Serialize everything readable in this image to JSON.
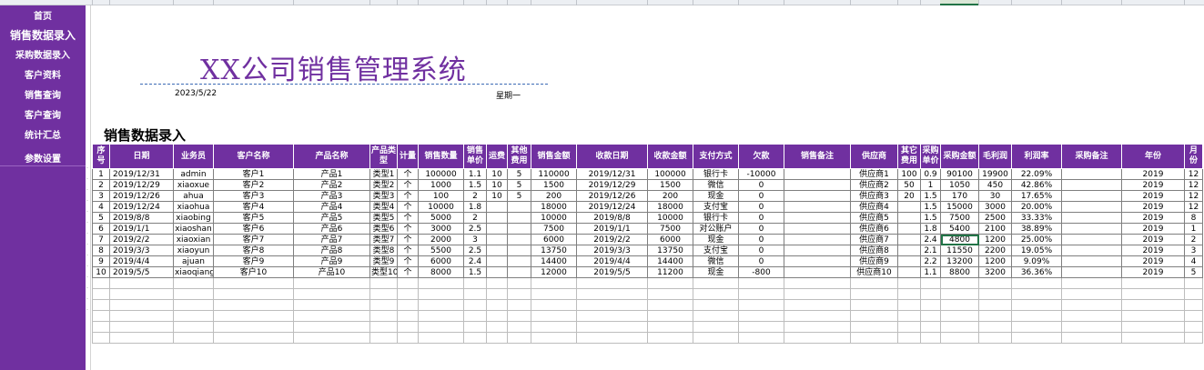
{
  "nav": {
    "items": [
      {
        "label": "首页",
        "size": "small"
      },
      {
        "label": "销售数据录入",
        "size": "big"
      },
      {
        "label": "采购数据录入",
        "size": "small"
      },
      {
        "label": "客户资料",
        "size": "small"
      },
      {
        "label": "销售查询",
        "size": "small"
      },
      {
        "label": "客户查询",
        "size": "small"
      },
      {
        "label": "统计汇总",
        "size": "small"
      },
      {
        "label": "参数设置",
        "size": "small"
      }
    ]
  },
  "header": {
    "title": "XX公司销售管理系统",
    "date": "2023/5/22",
    "weekday": "星期一"
  },
  "section_title": "销售数据录入",
  "table": {
    "headers": [
      "序号",
      "日期",
      "业务员",
      "客户名称",
      "产品名称",
      "产品类型",
      "计量",
      "销售数量",
      "销售单价",
      "运费",
      "其他费用",
      "销售金额",
      "收款日期",
      "收款金额",
      "支付方式",
      "欠款",
      "销售备注",
      "供应商",
      "其它费用",
      "采购单价",
      "采购金额",
      "毛利润",
      "利润率",
      "采购备注",
      "年份",
      "月份"
    ],
    "rows": [
      [
        "1",
        "2019/12/31",
        "admin",
        "客户1",
        "产品1",
        "类型1",
        "个",
        "100000",
        "1.1",
        "10",
        "5",
        "110000",
        "2019/12/31",
        "100000",
        "银行卡",
        "-10000",
        "",
        "供应商1",
        "100",
        "0.9",
        "90100",
        "19900",
        "22.09%",
        "",
        "2019",
        "12"
      ],
      [
        "2",
        "2019/12/29",
        "xiaoxue",
        "客户2",
        "产品2",
        "类型2",
        "个",
        "1000",
        "1.5",
        "10",
        "5",
        "1500",
        "2019/12/29",
        "1500",
        "微信",
        "0",
        "",
        "供应商2",
        "50",
        "1",
        "1050",
        "450",
        "42.86%",
        "",
        "2019",
        "12"
      ],
      [
        "3",
        "2019/12/26",
        "ahua",
        "客户3",
        "产品3",
        "类型3",
        "个",
        "100",
        "2",
        "10",
        "5",
        "200",
        "2019/12/26",
        "200",
        "现金",
        "0",
        "",
        "供应商3",
        "20",
        "1.5",
        "170",
        "30",
        "17.65%",
        "",
        "2019",
        "12"
      ],
      [
        "4",
        "2019/12/24",
        "xiaohua",
        "客户4",
        "产品4",
        "类型4",
        "个",
        "10000",
        "1.8",
        "",
        "",
        "18000",
        "2019/12/24",
        "18000",
        "支付宝",
        "0",
        "",
        "供应商4",
        "",
        "1.5",
        "15000",
        "3000",
        "20.00%",
        "",
        "2019",
        "12"
      ],
      [
        "5",
        "2019/8/8",
        "xiaobing",
        "客户5",
        "产品5",
        "类型5",
        "个",
        "5000",
        "2",
        "",
        "",
        "10000",
        "2019/8/8",
        "10000",
        "银行卡",
        "0",
        "",
        "供应商5",
        "",
        "1.5",
        "7500",
        "2500",
        "33.33%",
        "",
        "2019",
        "8"
      ],
      [
        "6",
        "2019/1/1",
        "xiaoshan",
        "客户6",
        "产品6",
        "类型6",
        "个",
        "3000",
        "2.5",
        "",
        "",
        "7500",
        "2019/1/1",
        "7500",
        "对公账户",
        "0",
        "",
        "供应商6",
        "",
        "1.8",
        "5400",
        "2100",
        "38.89%",
        "",
        "2019",
        "1"
      ],
      [
        "7",
        "2019/2/2",
        "xiaoxian",
        "客户7",
        "产品7",
        "类型7",
        "个",
        "2000",
        "3",
        "",
        "",
        "6000",
        "2019/2/2",
        "6000",
        "现金",
        "0",
        "",
        "供应商7",
        "",
        "2.4",
        "4800",
        "1200",
        "25.00%",
        "",
        "2019",
        "2"
      ],
      [
        "8",
        "2019/3/3",
        "xiaoyun",
        "客户8",
        "产品8",
        "类型8",
        "个",
        "5500",
        "2.5",
        "",
        "",
        "13750",
        "2019/3/3",
        "13750",
        "支付宝",
        "0",
        "",
        "供应商8",
        "",
        "2.1",
        "11550",
        "2200",
        "19.05%",
        "",
        "2019",
        "3"
      ],
      [
        "9",
        "2019/4/4",
        "ajuan",
        "客户9",
        "产品9",
        "类型9",
        "个",
        "6000",
        "2.4",
        "",
        "",
        "14400",
        "2019/4/4",
        "14400",
        "微信",
        "0",
        "",
        "供应商9",
        "",
        "2.2",
        "13200",
        "1200",
        "9.09%",
        "",
        "2019",
        "4"
      ],
      [
        "10",
        "2019/5/5",
        "xiaoqiang",
        "客户10",
        "产品10",
        "类型10",
        "个",
        "8000",
        "1.5",
        "",
        "",
        "12000",
        "2019/5/5",
        "11200",
        "现金",
        "-800",
        "",
        "供应商10",
        "",
        "1.1",
        "8800",
        "3200",
        "36.36%",
        "",
        "2019",
        "5"
      ]
    ]
  },
  "colors": {
    "accent": "#7030a0",
    "selection": "#217346"
  }
}
